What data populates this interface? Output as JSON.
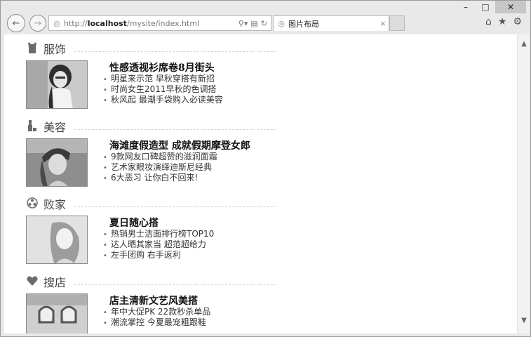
{
  "browser": {
    "address_url_prefix": "http://",
    "address_host": "localhost",
    "address_path": "/mysite/index.html",
    "tab_title": "图片布局",
    "icons": [
      "back-arrow-icon",
      "forward-arrow-icon",
      "ie-page-icon",
      "search-icon",
      "compat-view-icon",
      "refresh-icon",
      "close-icon",
      "home-icon",
      "favorites-star-icon",
      "settings-gear-icon",
      "minimize-icon",
      "maximize-icon"
    ]
  },
  "sections": [
    {
      "icon": "clothing-icon",
      "title": "服饰",
      "headline": "性感透视衫席卷8月街头",
      "items": [
        "明星来示范 早秋穿搭有新招",
        "时尚女生2011早秋的色调搭",
        "秋风起 最潮手袋购入必读美容"
      ]
    },
    {
      "icon": "cosmetics-icon",
      "title": "美容",
      "headline": "海滩度假造型 成就假期摩登女郎",
      "items": [
        "9款网友口碑超赞的滋润面霜",
        "艺术家眼妆演绎迪斯尼经典",
        "6大恶习 让你白不回来!"
      ]
    },
    {
      "icon": "shopping-reel-icon",
      "title": "败家",
      "headline": "夏日随心搭",
      "items": [
        "热销男士洁面排行榜TOP10",
        "达人晒其家当 超范超给力",
        "左手团购 右手返利"
      ]
    },
    {
      "icon": "heart-icon",
      "title": "搜店",
      "headline": "店主清新文艺风美搭",
      "items": [
        "年中大促PK 22款秒杀单品",
        "潮流掌控 今夏最宠粗跟鞋"
      ]
    }
  ]
}
